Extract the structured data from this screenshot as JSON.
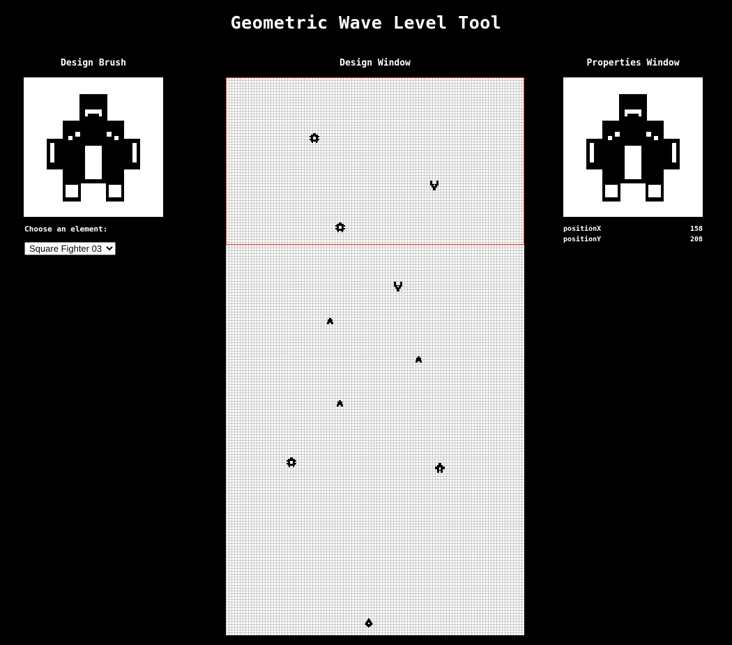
{
  "app": {
    "title": "Geometric Wave Level Tool"
  },
  "brush_panel": {
    "title": "Design Brush",
    "choose_label": "Choose an element:",
    "select_value": "Square Fighter 03",
    "preview_icon": "square-fighter-sprite"
  },
  "design_panel": {
    "title": "Design Window",
    "grid_color": "#c8c8c8",
    "view_region_color": "#ff4040",
    "entities": [
      {
        "type": "bug-enemy-icon"
      },
      {
        "type": "claw-enemy-icon"
      },
      {
        "type": "bug-enemy-icon"
      },
      {
        "type": "claw-enemy-icon"
      },
      {
        "type": "small-pod-icon"
      },
      {
        "type": "small-pod-icon"
      },
      {
        "type": "small-pod-icon"
      },
      {
        "type": "bug-enemy-icon"
      },
      {
        "type": "square-fighter-icon"
      },
      {
        "type": "player-ship-icon"
      }
    ]
  },
  "properties_panel": {
    "title": "Properties Window",
    "preview_icon": "square-fighter-sprite",
    "properties": [
      {
        "name": "positionX",
        "value": "158"
      },
      {
        "name": "positionY",
        "value": "208"
      }
    ]
  }
}
